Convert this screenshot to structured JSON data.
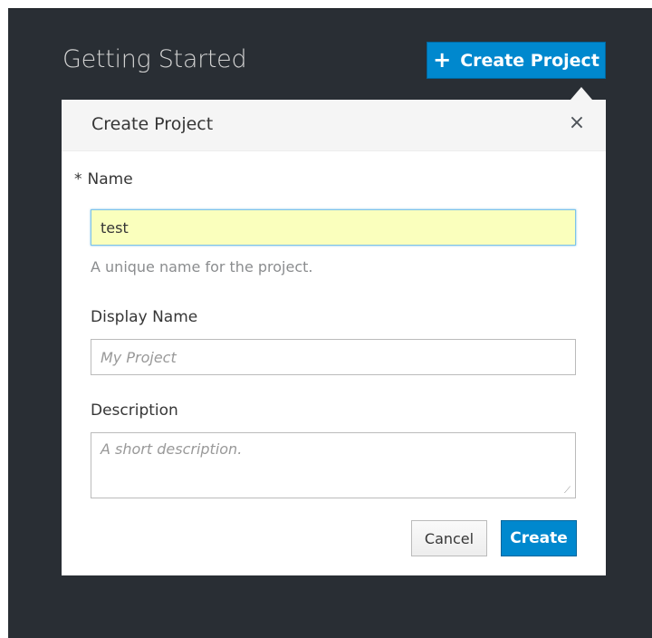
{
  "page": {
    "title": "Getting Started",
    "create_project_button": "Create Project",
    "create_project_icon": "plus-icon"
  },
  "popover": {
    "title": "Create Project",
    "close_icon": "close-icon",
    "close_glyph": "×"
  },
  "form": {
    "name": {
      "required_marker": "*",
      "label": "Name",
      "value": "test",
      "help": "A unique name for the project."
    },
    "display_name": {
      "label": "Display Name",
      "value": "",
      "placeholder": "My Project"
    },
    "description": {
      "label": "Description",
      "value": "",
      "placeholder": "A short description."
    }
  },
  "actions": {
    "cancel_label": "Cancel",
    "create_label": "Create"
  },
  "colors": {
    "background": "#292e34",
    "primary": "#0088ce",
    "autofill": "#faffbd"
  }
}
